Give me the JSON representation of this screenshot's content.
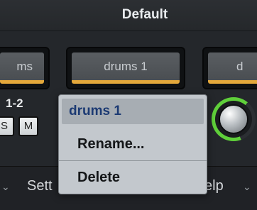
{
  "window": {
    "title": "Default"
  },
  "tracks": {
    "left": {
      "label": "ms"
    },
    "middle": {
      "label": "drums 1"
    },
    "right": {
      "label": "d"
    }
  },
  "channel": {
    "label": "1-2",
    "solo": "S",
    "mute": "M"
  },
  "bottom": {
    "left_label": "Sett",
    "right_label": "elp"
  },
  "context_menu": {
    "title": "drums 1",
    "items": [
      "Rename...",
      "Delete"
    ]
  },
  "colors": {
    "accent": "#e4a83b",
    "menu_title": "#1c3a73",
    "knob_ring": "#5fcf3a",
    "menu_bg": "#c3c8cd"
  }
}
